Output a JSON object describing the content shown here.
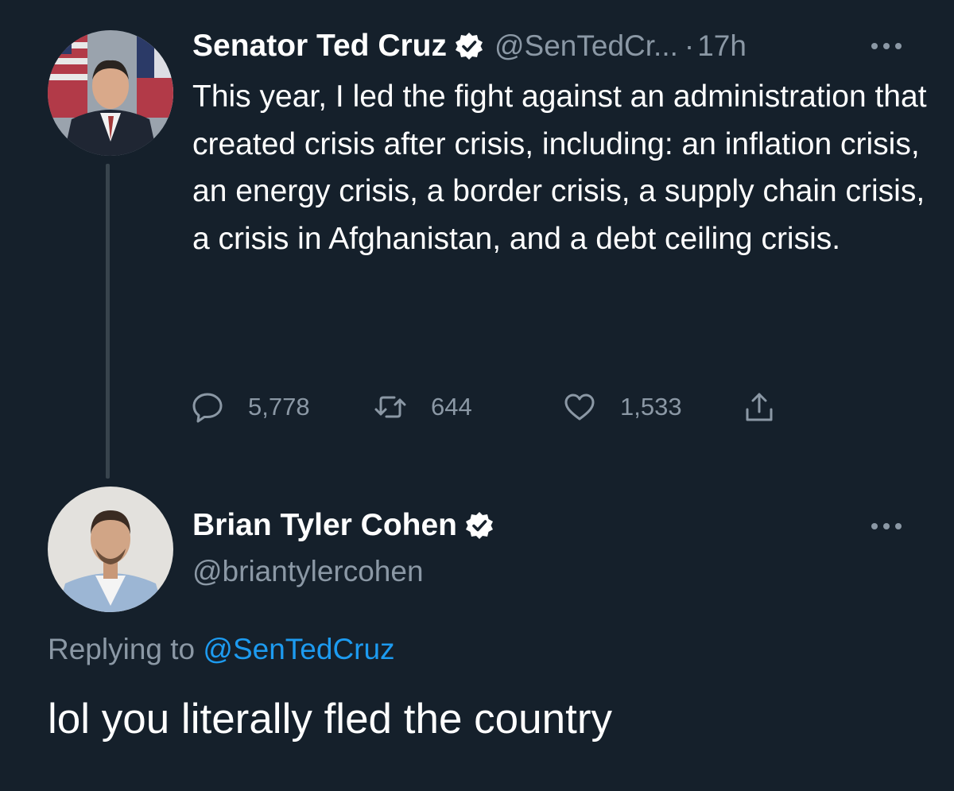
{
  "tweet": {
    "author_name": "Senator Ted Cruz",
    "handle": "@SenTedCr...",
    "separator": "·",
    "time": "17h",
    "verified_icon": "verified-badge-icon",
    "more_icon": "more-horizontal-icon",
    "text": "This year, I led the fight against an administration that created crisis after crisis, including: an inflation crisis, an energy crisis, a border crisis, a supply chain crisis, a crisis in Afghanistan, and a debt ceiling crisis.",
    "actions": {
      "replies": "5,778",
      "retweets": "644",
      "likes": "1,533"
    }
  },
  "reply": {
    "author_name": "Brian Tyler Cohen",
    "handle": "@briantylercohen",
    "replying_prefix": "Replying to",
    "replying_to": "@SenTedCruz",
    "text": "lol you literally fled the country"
  },
  "colors": {
    "background": "#15202b",
    "text_primary": "#ffffff",
    "text_secondary": "#8b98a5",
    "link": "#1d9bf0",
    "thread_line": "#38444d"
  }
}
